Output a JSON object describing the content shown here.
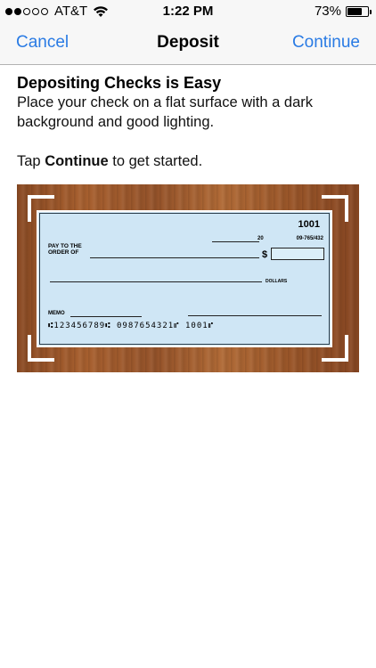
{
  "status_bar": {
    "carrier": "AT&T",
    "time": "1:22 PM",
    "battery_percent": "73%",
    "battery_level": 0.73,
    "signal_bars": 2,
    "icons": [
      "signal-dots-icon",
      "wifi-icon",
      "battery-icon"
    ]
  },
  "nav": {
    "left_label": "Cancel",
    "title": "Deposit",
    "right_label": "Continue",
    "accent_color": "#2a7be4"
  },
  "content": {
    "heading": "Depositing Checks is Easy",
    "description": "Place your check on a flat surface with a dark background and good lighting.",
    "instruction_prefix": "Tap ",
    "instruction_bold": "Continue",
    "instruction_suffix": " to get started."
  },
  "check": {
    "number": "1001",
    "date_suffix": "20",
    "routing_fraction": "09-765/432",
    "pay_label": "PAY TO THE ORDER OF",
    "dollar_sign": "$",
    "dollars_label": "DOLLARS",
    "memo_label": "MEMO",
    "micr_line": "⑆123456789⑆  0987654321⑈  1001⑈"
  }
}
